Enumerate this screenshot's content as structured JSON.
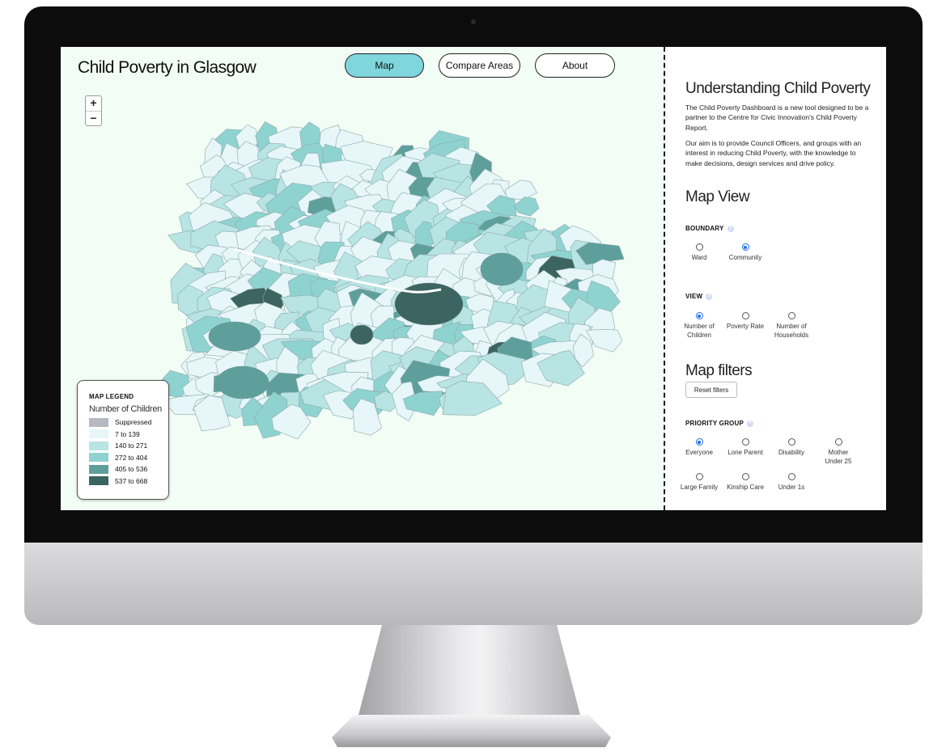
{
  "app": {
    "title": "Child Poverty in Glasgow",
    "nav": {
      "map": "Map",
      "compare": "Compare Areas",
      "about": "About"
    }
  },
  "zoom": {
    "in": "+",
    "out": "−"
  },
  "legend": {
    "title": "MAP LEGEND",
    "subtitle": "Number of Children",
    "items": [
      {
        "label": "Suppressed",
        "color": "#b8b8c0"
      },
      {
        "label": "7 to 139",
        "color": "#e6f6f9"
      },
      {
        "label": "140 to 271",
        "color": "#b8e4e4"
      },
      {
        "label": "272 to 404",
        "color": "#8fd3d1"
      },
      {
        "label": "405 to 536",
        "color": "#5e9f9c"
      },
      {
        "label": "537 to 668",
        "color": "#3c6460"
      }
    ]
  },
  "panel": {
    "heading": "Understanding Child Poverty",
    "para1": "The Child Poverty Dashboard is a new tool designed to be a partner to the Centre for Civic Innovation's Child Poverty Report.",
    "para2": "Our aim is to provide Council Officers, and groups with an interest in reducing Child Poverty, with the knowledge to make decisions, design services and drive policy.",
    "map_view": "Map View",
    "boundary": {
      "label": "BOUNDARY",
      "options": [
        "Ward",
        "Community"
      ],
      "selected": "Community"
    },
    "view": {
      "label": "VIEW",
      "options": [
        [
          "Number of",
          "Children"
        ],
        [
          "Poverty Rate"
        ],
        [
          "Number of",
          "Households"
        ]
      ],
      "selected": "Number of Children"
    },
    "filters_heading": "Map filters",
    "reset": "Reset filters",
    "priority": {
      "label": "PRIORITY GROUP",
      "options": [
        [
          "Everyone"
        ],
        [
          "Lone Parent"
        ],
        [
          "Disability"
        ],
        [
          "Mother",
          "Under 25"
        ],
        [
          "Large Family"
        ],
        [
          "Kinship Care"
        ],
        [
          "Under 1s"
        ]
      ],
      "selected": "Everyone"
    },
    "info_icon": "?"
  },
  "colors": {
    "nav_active": "#7fd6dc",
    "map_background": "#f2fdf5",
    "radio_selected": "#1d6fe3"
  }
}
